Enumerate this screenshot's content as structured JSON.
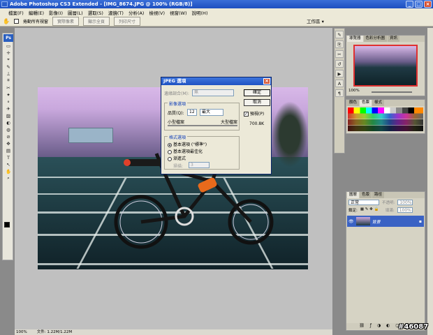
{
  "window": {
    "title": "Adobe Photoshop CS3 Extended - [IMG_8674.JPG @ 100% (RGB/8)]",
    "min": "_",
    "max": "□",
    "close": "×"
  },
  "menu": [
    "檔案(F)",
    "編輯(E)",
    "影像(I)",
    "圖層(L)",
    "選取(S)",
    "濾鏡(T)",
    "分析(A)",
    "檢視(V)",
    "視窗(W)",
    "說明(H)"
  ],
  "options": {
    "resize_all": "捲動所有視窗",
    "actual_pixels": "實際像素",
    "fit_screen": "顯示全頁",
    "print_size": "列印尺寸",
    "workspace": "工作區 ▾"
  },
  "tools": {
    "logo": "Ps",
    "icons": [
      "▭",
      "✛",
      "⌖",
      "✎",
      "⟂",
      "⌗",
      "✂",
      "✦",
      "⚬",
      "✈",
      "▨",
      "◐",
      "◍",
      "⊘",
      "✥",
      "▤",
      "T",
      "↖",
      "✋",
      "⌕"
    ]
  },
  "dialog": {
    "title": "JPEG 選項",
    "matte_label": "邊緣調合(M):",
    "matte_value": "無",
    "image_options": "影像選項",
    "quality_label": "品質(Q):",
    "quality_value": "12",
    "quality_select": "最大",
    "small_file": "小型檔案",
    "large_file": "大型檔案",
    "format_options": "格式選項",
    "format_baseline": "基本選項 (\"標準\")",
    "format_optimized": "基本選項最佳化",
    "format_progressive": "漸進式",
    "scans_label": "掃描:",
    "scans_value": "3",
    "ok": "確定",
    "cancel": "取消",
    "preview": "預視(P)",
    "size": "700.8K"
  },
  "status": {
    "zoom": "100%",
    "doc": "文件: 1.22M/1.22M"
  },
  "navigator": {
    "tabs": [
      "導覽器",
      "色彩分析圖",
      "資訊"
    ],
    "zoom": "100%"
  },
  "swatches": {
    "tabs": [
      "顏色",
      "色票",
      "樣式"
    ]
  },
  "layers": {
    "tabs": [
      "圖層",
      "色版",
      "路徑"
    ],
    "blend": "正常",
    "opacity_label": "不透明:",
    "opacity_value": "100%",
    "lock_label": "鎖定:",
    "fill_label": "填滿:",
    "fill_value": "100%",
    "layer_name": "背景"
  },
  "watermark": "#46087"
}
